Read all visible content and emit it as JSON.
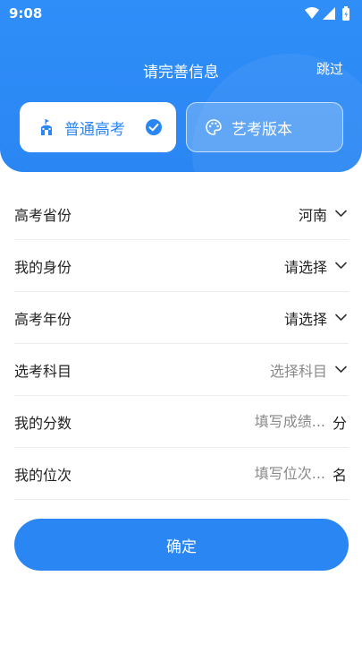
{
  "status_bar": {
    "time": "9:08"
  },
  "header": {
    "title": "请完善信息",
    "skip_label": "跳过"
  },
  "modes": [
    {
      "label": "普通高考",
      "icon": "building-icon",
      "selected": true
    },
    {
      "label": "艺考版本",
      "icon": "palette-icon",
      "selected": false
    }
  ],
  "form": {
    "province": {
      "label": "高考省份",
      "value": "河南"
    },
    "identity": {
      "label": "我的身份",
      "value": "请选择"
    },
    "year": {
      "label": "高考年份",
      "value": "请选择"
    },
    "subjects": {
      "label": "选考科目",
      "value": "选择科目"
    },
    "score": {
      "label": "我的分数",
      "placeholder": "填写成绩...",
      "unit": "分"
    },
    "rank": {
      "label": "我的位次",
      "placeholder": "填写位次...",
      "unit": "名"
    }
  },
  "confirm_label": "确定",
  "colors": {
    "primary": "#2a86f3",
    "text": "#222222",
    "placeholder": "#8a8a8a"
  }
}
